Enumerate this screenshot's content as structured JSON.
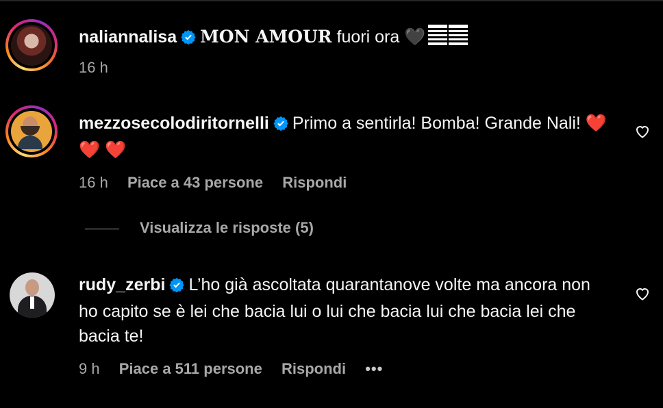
{
  "post": {
    "username": "naliannalisa",
    "caption_bold": "MON AMOUR",
    "caption_rest": " fuori ora 🖤",
    "time": "16 h"
  },
  "comments": [
    {
      "username": "mezzosecolodiritornelli",
      "text": "Primo a sentirla! Bomba! Grande Nali! ❤️ ❤️ ❤️",
      "time": "16 h",
      "likes": "Piace a 43 persone",
      "reply": "Rispondi",
      "view_replies": "Visualizza le risposte (5)"
    },
    {
      "username": "rudy_zerbi",
      "text": "L’ho già ascoltata quarantanove volte ma ancora non ho capito se è lei che bacia lui o lui che bacia lui che bacia lei che bacia te!",
      "time": "9 h",
      "likes": "Piace a 511 persone",
      "reply": "Rispondi",
      "more": "•••"
    }
  ],
  "colors": {
    "background": "#000000",
    "text": "#f5f5f5",
    "muted": "#a8a8a8",
    "verified": "#0095f6",
    "heart": "#ff2d2d"
  },
  "icons": [
    "verified-badge-icon",
    "heart-outline-icon",
    "more-options-icon"
  ]
}
